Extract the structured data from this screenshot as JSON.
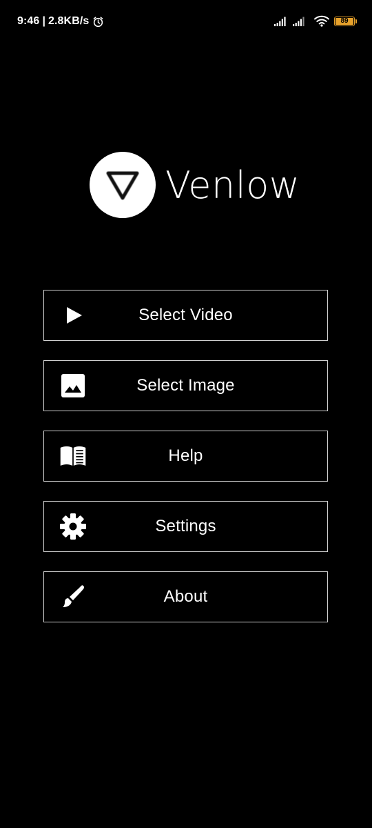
{
  "status_bar": {
    "time": "9:46",
    "separator": "|",
    "net_speed": "2.8KB/s",
    "battery_level": "89",
    "battery_color": "#e6a12b",
    "icons": [
      "alarm-icon",
      "signal-icon",
      "signal-icon",
      "wifi-icon",
      "battery-icon"
    ]
  },
  "logo": {
    "app_name": "Venlow",
    "icon": "down-triangle-icon"
  },
  "menu": {
    "items": [
      {
        "label": "Select Video",
        "icon": "play-icon"
      },
      {
        "label": "Select Image",
        "icon": "image-icon"
      },
      {
        "label": "Help",
        "icon": "book-icon"
      },
      {
        "label": "Settings",
        "icon": "gear-icon"
      },
      {
        "label": "About",
        "icon": "brush-icon"
      }
    ]
  },
  "colors": {
    "background": "#000000",
    "text": "#ffffff",
    "button_border": "#cfcfcf"
  }
}
